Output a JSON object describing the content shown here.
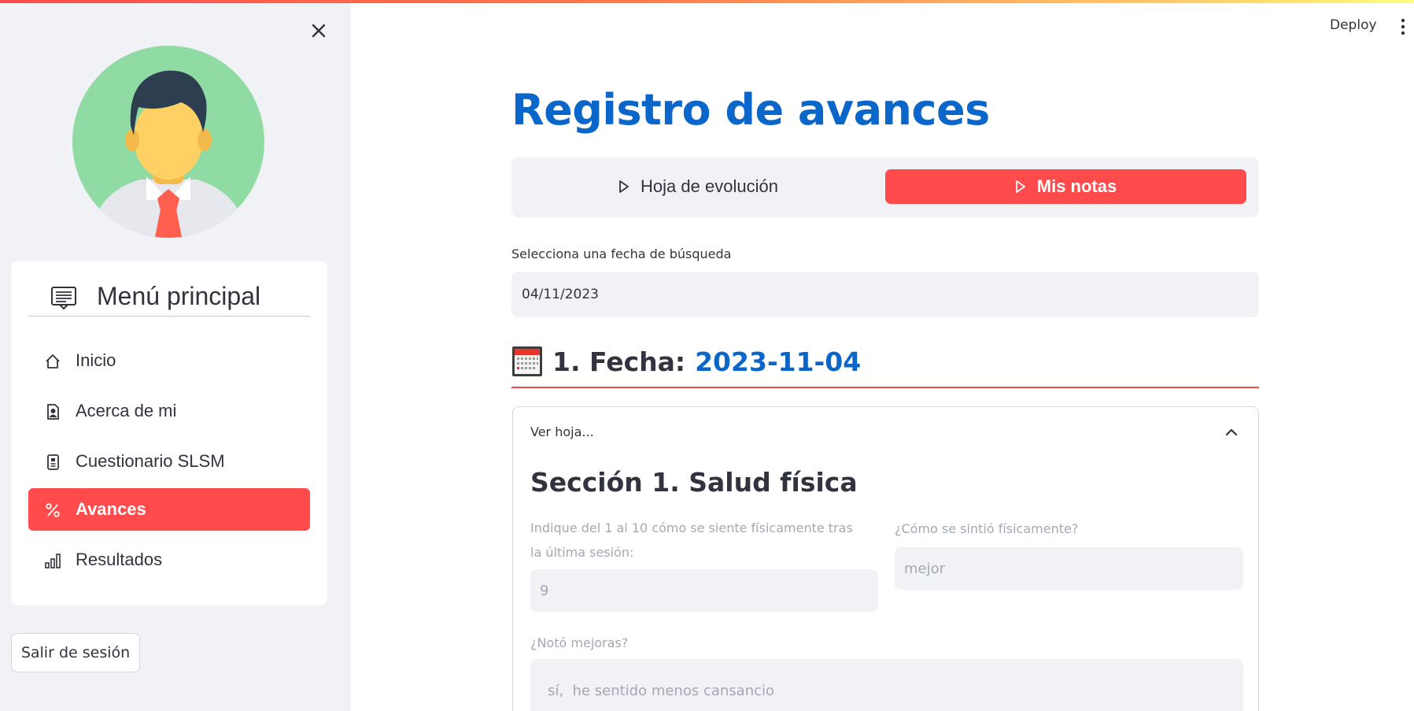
{
  "app": {
    "deploy_label": "Deploy"
  },
  "sidebar": {
    "menu_title": "Menú principal",
    "items": [
      {
        "label": "Inicio",
        "icon": "house-icon"
      },
      {
        "label": "Acerca de mi",
        "icon": "person-badge-icon"
      },
      {
        "label": "Cuestionario SLSM",
        "icon": "clipboard-icon"
      },
      {
        "label": "Avances",
        "icon": "percent-icon",
        "active": true
      },
      {
        "label": "Resultados",
        "icon": "bar-chart-icon"
      }
    ],
    "logout_label": "Salir de sesión"
  },
  "main": {
    "title": "Registro de avances",
    "tabs": [
      {
        "label": "Hoja de evolución",
        "active": false
      },
      {
        "label": "Mis notas",
        "active": true
      }
    ],
    "date_label": "Selecciona una fecha de búsqueda",
    "date_value": "04/11/2023",
    "section_prefix": "1. Fecha:",
    "section_date": "2023-11-04",
    "expander": {
      "title": "Ver hoja...",
      "section_title": "Sección 1. Salud física",
      "q1_label": "Indique del 1 al 10 cómo se siente físicamente tras la última sesión:",
      "q1_value": "9",
      "q2_label": "¿Cómo se sintió físicamente?",
      "q2_value": "mejor",
      "q3_label": "¿Notó mejoras?",
      "q3_value": "sí,  he sentido menos cansancio"
    }
  },
  "colors": {
    "accent": "#ff4b4b",
    "title_blue": "#0b66c9",
    "sidebar_bg": "#f0f2f6",
    "text": "#31333f"
  }
}
